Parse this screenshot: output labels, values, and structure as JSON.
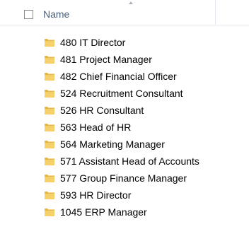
{
  "header": {
    "name_label": "Name"
  },
  "folders": [
    {
      "label": "480 IT Director"
    },
    {
      "label": "481 Project Manager"
    },
    {
      "label": "482 Chief Financial Officer"
    },
    {
      "label": "524 Recruitment Consultant"
    },
    {
      "label": "526 HR Consultant"
    },
    {
      "label": "563 Head of HR"
    },
    {
      "label": "564 Marketing Manager"
    },
    {
      "label": "571 Assistant Head of Accounts"
    },
    {
      "label": "577 Group Finance Manager"
    },
    {
      "label": "593 HR Director"
    },
    {
      "label": "1045 ERP Manager"
    }
  ],
  "colors": {
    "header_text": "#4c607a",
    "folder_yellow": "#f2c14e"
  }
}
